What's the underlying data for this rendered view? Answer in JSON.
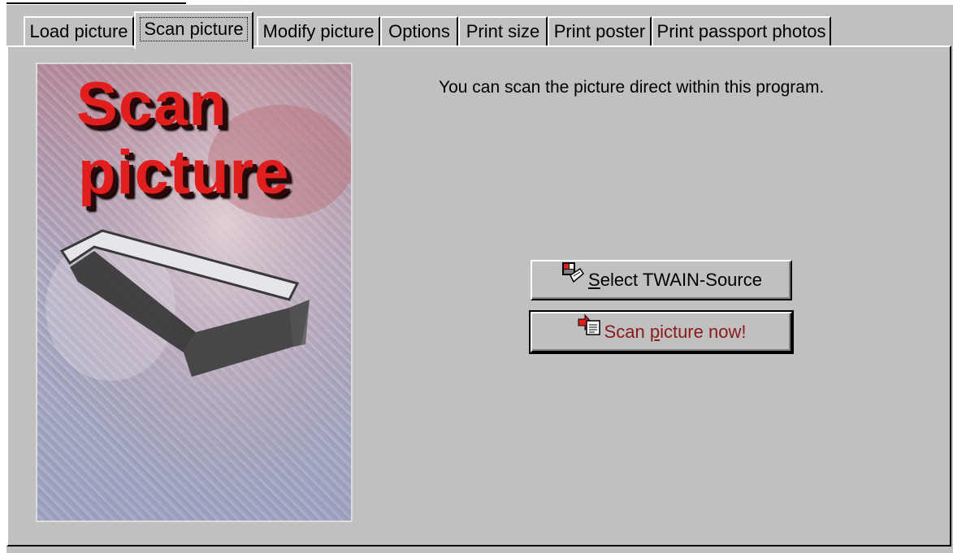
{
  "tabs": [
    {
      "label": "Load picture",
      "active": false
    },
    {
      "label": "Scan picture",
      "active": true
    },
    {
      "label": "Modify picture",
      "active": false
    },
    {
      "label": "Options",
      "active": false
    },
    {
      "label": "Print size",
      "active": false
    },
    {
      "label": "Print poster",
      "active": false
    },
    {
      "label": "Print passport photos",
      "active": false
    }
  ],
  "banner": {
    "line1": "Scan",
    "line2": "picture"
  },
  "info_text": "You can scan the picture direct within this program.",
  "buttons": {
    "select_twain": {
      "underlined": "S",
      "rest": "elect TWAIN-Source",
      "icon": "twain-source-icon"
    },
    "scan_now": {
      "before": "Scan ",
      "underlined": "p",
      "after": "icture now!",
      "icon": "scan-now-icon"
    }
  },
  "colors": {
    "window_bg": "#c0c0c0",
    "banner_text": "#e01e1e",
    "scan_button_text": "#8b1a1a"
  }
}
